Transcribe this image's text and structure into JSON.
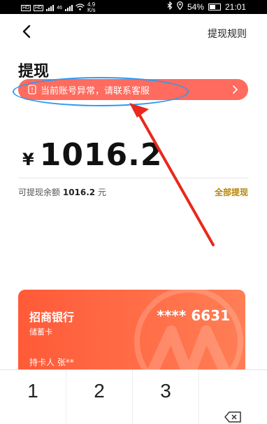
{
  "status_bar": {
    "tag1": "HD",
    "tag2": "HD",
    "signal1": "46",
    "speed_value": "4.9",
    "speed_unit": "K/s",
    "battery": "54%",
    "time": "21:01"
  },
  "header": {
    "title": "提现",
    "rules_link": "提现规则"
  },
  "alert": {
    "text": "当前账号异常，请联系客服"
  },
  "amount": {
    "currency": "¥",
    "value": "1016.2"
  },
  "available": {
    "label": "可提现余额",
    "value": "1016.2",
    "unit": "元",
    "withdraw_all": "全部提现"
  },
  "card": {
    "bank_name": "招商银行",
    "card_type": "储蓄卡",
    "number": "**** 6631",
    "holder": "持卡人 张**"
  },
  "keypad": {
    "keys": [
      "1",
      "2",
      "3"
    ]
  },
  "colors": {
    "alert_bg": "#ff6b5e",
    "annotation_circle": "#2a9bf5",
    "annotation_arrow": "#e8291c",
    "card_gradient_start": "#ff5a38",
    "card_gradient_end": "#ff7e55",
    "withdraw_all": "#b8860b"
  },
  "icons": [
    "back-arrow-icon",
    "phone-alert-icon",
    "chevron-right-icon",
    "bank-logo-icon",
    "backspace-icon"
  ]
}
